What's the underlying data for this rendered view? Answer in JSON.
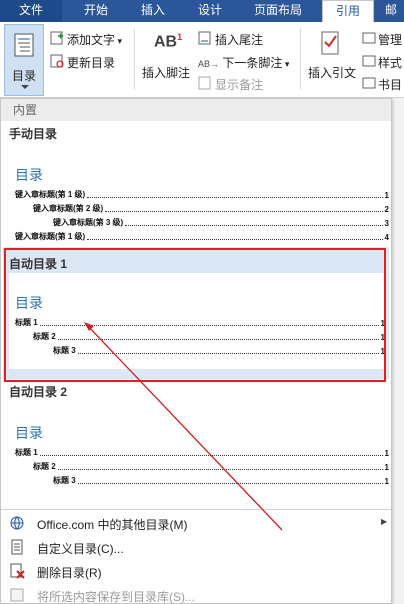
{
  "tabs": [
    {
      "label": "文件"
    },
    {
      "label": "开始"
    },
    {
      "label": "插入"
    },
    {
      "label": "设计"
    },
    {
      "label": "页面布局"
    },
    {
      "label": "引用"
    },
    {
      "label": "邮"
    }
  ],
  "ribbon": {
    "toc_label": "目录",
    "add_text": "添加文字",
    "update_toc": "更新目录",
    "insert_footnote": "插入脚注",
    "footnote_icon_text": "AB",
    "footnote_icon_sup": "1",
    "insert_endnote": "插入尾注",
    "next_footnote": "下一条脚注",
    "show_notes": "显示备注",
    "insert_citation": "插入引文",
    "manage": "管理",
    "style": "样式",
    "bibliography": "书目"
  },
  "panel": {
    "header": "内置",
    "manual": {
      "title": "手动目录",
      "toc_title": "目录",
      "rows": [
        {
          "label": "键入章标题(第 1 级)",
          "num": "1"
        },
        {
          "label": "键入章标题(第 2 级)",
          "num": "2"
        },
        {
          "label": "键入章标题(第 3 级)",
          "num": "3"
        },
        {
          "label": "键入章标题(第 1 级)",
          "num": "4"
        }
      ]
    },
    "auto1": {
      "title": "自动目录 1",
      "toc_title": "目录",
      "rows": [
        {
          "label": "标题 1",
          "num": "1"
        },
        {
          "label": "标题 2",
          "num": "1"
        },
        {
          "label": "标题 3",
          "num": "1"
        }
      ]
    },
    "auto2": {
      "title": "自动目录 2",
      "toc_title": "目录",
      "rows": [
        {
          "label": "标题 1",
          "num": "1"
        },
        {
          "label": "标题 2",
          "num": "1"
        },
        {
          "label": "标题 3",
          "num": "1"
        }
      ]
    },
    "menu": [
      {
        "label": "Office.com 中的其他目录(M)",
        "has_submenu": true
      },
      {
        "label": "自定义目录(C)...",
        "has_submenu": false
      },
      {
        "label": "删除目录(R)",
        "has_submenu": false
      },
      {
        "label": "将所选内容保存到目录库(S)...",
        "has_submenu": false
      }
    ],
    "submenu_arrow": "▶"
  },
  "colors": {
    "ribbon_tab_bg": "#2b579a",
    "toc_title": "#2e74b5",
    "highlight": "#dbe7f4",
    "annotation_red": "#e02020"
  }
}
